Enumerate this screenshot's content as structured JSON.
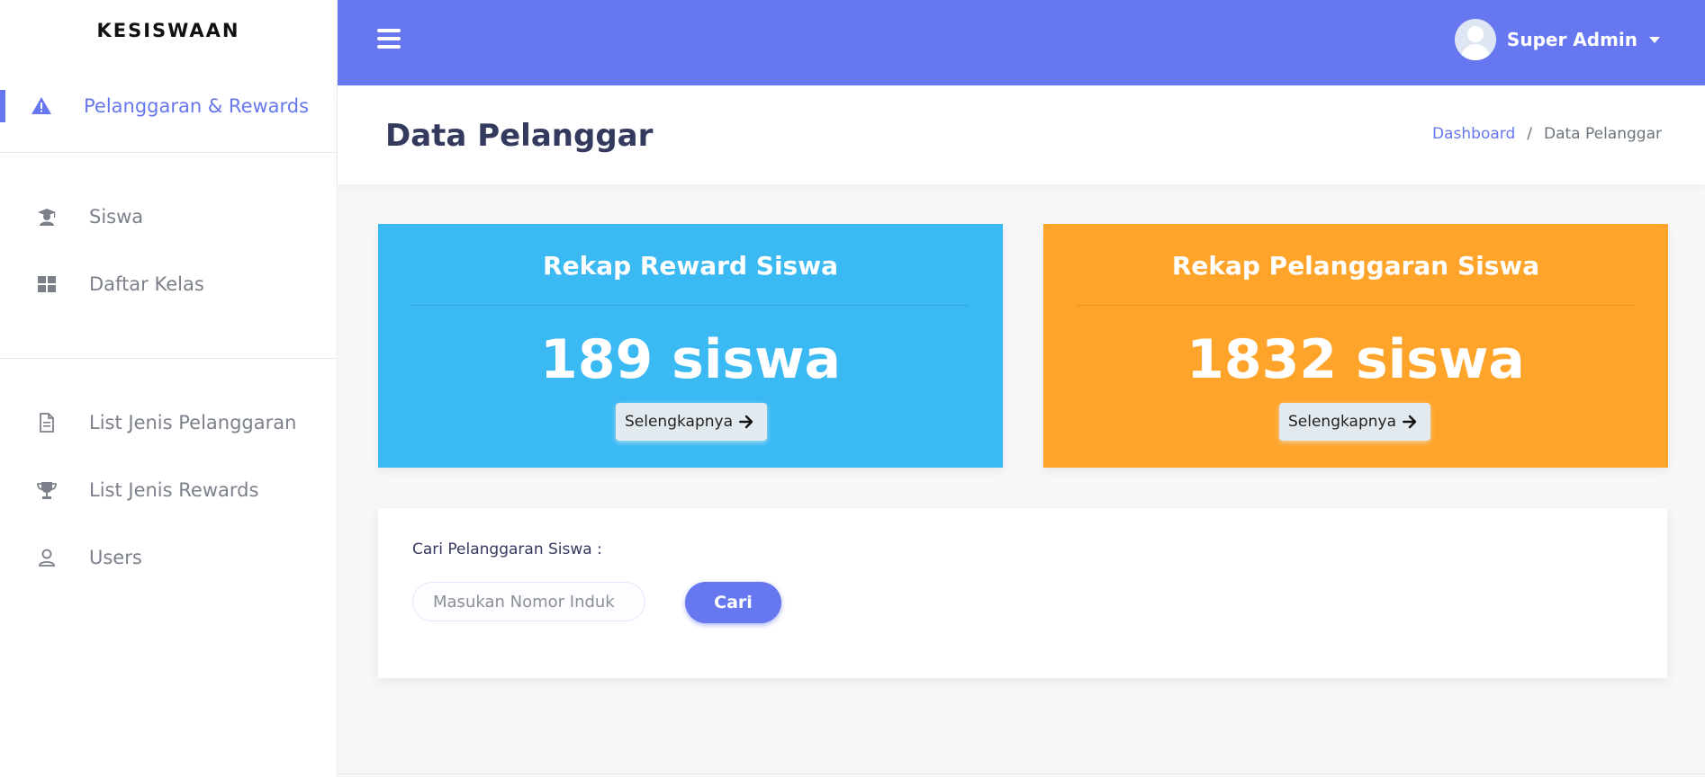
{
  "sidebar": {
    "brand": "KESISWAAN",
    "active_item": {
      "label": "Pelanggaran & Rewards",
      "icon": "warning-icon"
    },
    "group1": [
      {
        "label": "Siswa",
        "icon": "graduate-icon"
      },
      {
        "label": "Daftar Kelas",
        "icon": "grid-icon"
      }
    ],
    "group2": [
      {
        "label": "List Jenis Pelanggaran",
        "icon": "file-icon"
      },
      {
        "label": "List Jenis Rewards",
        "icon": "trophy-icon"
      },
      {
        "label": "Users",
        "icon": "user-icon"
      }
    ]
  },
  "topbar": {
    "user_name": "Super Admin"
  },
  "header": {
    "title": "Data Pelanggar",
    "breadcrumb": {
      "home": "Dashboard",
      "separator": "/",
      "current": "Data Pelanggar"
    }
  },
  "cards": {
    "reward": {
      "title": "Rekap Reward Siswa",
      "value": "189 siswa",
      "button": "Selengkapnya"
    },
    "pelanggaran": {
      "title": "Rekap Pelanggaran Siswa",
      "value": "1832 siswa",
      "button": "Selengkapnya"
    }
  },
  "search": {
    "label": "Cari Pelanggaran Siswa :",
    "placeholder": "Masukan Nomor Induk",
    "button": "Cari"
  },
  "colors": {
    "accent": "#6777ef",
    "reward_card": "#3bb9f3",
    "pelanggaran_card": "#ffa42a"
  }
}
